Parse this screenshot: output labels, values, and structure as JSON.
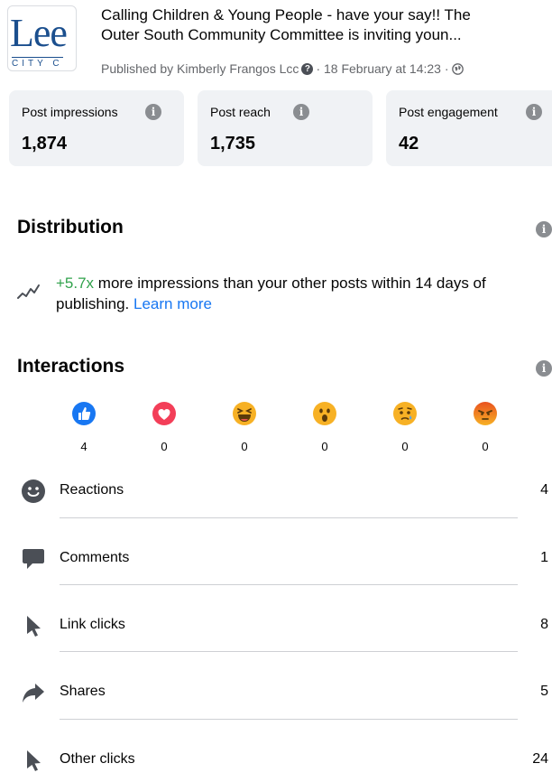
{
  "post": {
    "logo_text": "Lee",
    "logo_sub": "CITY C",
    "title_line1": "Calling Children & Young People - have your say!! The",
    "title_line2": "Outer South Community Committee is inviting youn...",
    "published_by": "Published by Kimberly Frangos Lcc",
    "date": "· 18 February at 14:23 ·"
  },
  "stats": [
    {
      "label": "Post impressions",
      "value": "1,874"
    },
    {
      "label": "Post reach",
      "value": "1,735"
    },
    {
      "label": "Post engagement",
      "value": "42"
    }
  ],
  "distribution": {
    "title": "Distribution",
    "highlight": "+5.7x",
    "text": " more impressions than your other posts within 14 days of publishing. ",
    "link": "Learn more"
  },
  "interactions": {
    "title": "Interactions",
    "reactions": [
      {
        "icon": "like-icon",
        "count": "4"
      },
      {
        "icon": "love-icon",
        "count": "0"
      },
      {
        "icon": "haha-icon",
        "count": "0"
      },
      {
        "icon": "wow-icon",
        "count": "0"
      },
      {
        "icon": "sad-icon",
        "count": "0"
      },
      {
        "icon": "angry-icon",
        "count": "0"
      }
    ],
    "rows": [
      {
        "icon": "smiley-icon",
        "label": "Reactions",
        "value": "4"
      },
      {
        "icon": "comment-icon",
        "label": "Comments",
        "value": "1"
      },
      {
        "icon": "cursor-icon",
        "label": "Link clicks",
        "value": "8"
      },
      {
        "icon": "share-icon",
        "label": "Shares",
        "value": "5"
      },
      {
        "icon": "cursor-icon",
        "label": "Other clicks",
        "value": "24"
      }
    ]
  },
  "colors": {
    "accent_blue": "#1877f2",
    "positive_green": "#31a24c",
    "card_bg": "#f0f2f5",
    "muted_text": "#65676b"
  }
}
